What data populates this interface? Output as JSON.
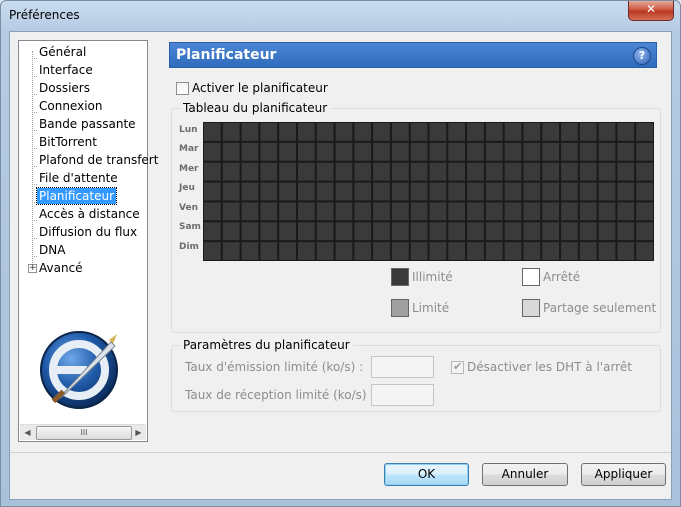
{
  "window": {
    "title": "Préférences",
    "close_label": "✕"
  },
  "tree": {
    "items": [
      {
        "label": "Général"
      },
      {
        "label": "Interface"
      },
      {
        "label": "Dossiers"
      },
      {
        "label": "Connexion"
      },
      {
        "label": "Bande passante"
      },
      {
        "label": "BitTorrent"
      },
      {
        "label": "Plafond de transfert"
      },
      {
        "label": "File d'attente"
      },
      {
        "label": "Planificateur"
      },
      {
        "label": "Accès à distance"
      },
      {
        "label": "Diffusion du flux"
      },
      {
        "label": "DNA"
      },
      {
        "label": "Avancé"
      }
    ],
    "selected": "Planificateur",
    "expander_label": "+",
    "scroll_thumb_label": "III"
  },
  "panel": {
    "title": "Planificateur",
    "help_label": "?",
    "enable_checkbox_label": "Activer le planificateur",
    "enable_checked": false
  },
  "schedule": {
    "group_title": "Tableau du planificateur",
    "days": [
      "Lun",
      "Mar",
      "Mer",
      "Jeu",
      "Ven",
      "Sam",
      "Dim"
    ],
    "hours_per_day": 24,
    "cell_color": "#3a3a3a",
    "legend": {
      "unlimited": {
        "label": "Illimité",
        "color": "#3a3a3a"
      },
      "stopped": {
        "label": "Arrêté",
        "color": "#ffffff"
      },
      "limited": {
        "label": "Limité",
        "color": "#a0a0a0"
      },
      "seed_only": {
        "label": "Partage seulement",
        "color": "#d9d9d9"
      }
    }
  },
  "settings": {
    "group_title": "Paramètres du planificateur",
    "upload_label": "Taux d'émission limité (ko/s) :",
    "download_label": "Taux de réception limité (ko/s) :",
    "upload_value": "",
    "download_value": "",
    "dht_label": "Désactiver les DHT à l'arrêt",
    "dht_checked": true
  },
  "buttons": {
    "ok": "OK",
    "cancel": "Annuler",
    "apply": "Appliquer"
  }
}
